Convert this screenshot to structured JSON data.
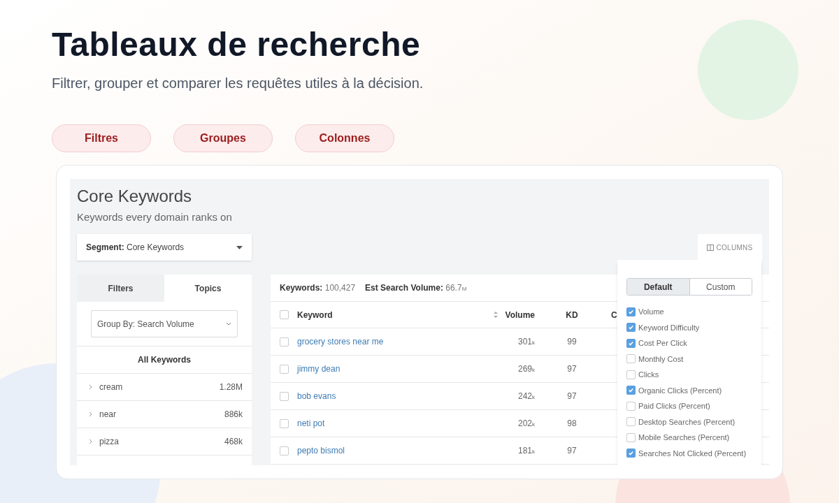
{
  "hero": {
    "title": "Tableaux de recherche",
    "subtitle": "Filtrer, grouper et comparer les requêtes utiles à la décision."
  },
  "pills": [
    {
      "label": "Filtres"
    },
    {
      "label": "Groupes"
    },
    {
      "label": "Colonnes"
    }
  ],
  "app": {
    "title": "Core Keywords",
    "subtitle": "Keywords every domain ranks on",
    "segment": {
      "label": "Segment:",
      "value": "Core Keywords"
    },
    "columns_button": "COLUMNS",
    "side_tabs": [
      {
        "label": "Filters",
        "selected": false
      },
      {
        "label": "Topics",
        "selected": true
      }
    ],
    "group_by": "Group By: Search Volume",
    "all_keywords": "All Keywords",
    "topics": [
      {
        "name": "cream",
        "volume": "1.28M"
      },
      {
        "name": "near",
        "volume": "886k"
      },
      {
        "name": "pizza",
        "volume": "468k"
      }
    ],
    "summary": [
      {
        "label": "Keywords:",
        "value": "100,427"
      },
      {
        "label": "Est Search Volume:",
        "value": "66.7",
        "unit": "M"
      }
    ],
    "table": {
      "all_selected": false,
      "columns": [
        "Keyword",
        "Volume",
        "KD",
        "C"
      ],
      "rows": [
        {
          "keyword": "grocery stores near me",
          "volume": "301",
          "unit": "k",
          "kd": "99",
          "checked": false
        },
        {
          "keyword": "jimmy dean",
          "volume": "269",
          "unit": "k",
          "kd": "97",
          "checked": false
        },
        {
          "keyword": "bob evans",
          "volume": "242",
          "unit": "k",
          "kd": "97",
          "checked": false
        },
        {
          "keyword": "neti pot",
          "volume": "202",
          "unit": "k",
          "kd": "98",
          "checked": false
        },
        {
          "keyword": "pepto bismol",
          "volume": "181",
          "unit": "k",
          "kd": "97",
          "checked": false
        }
      ]
    },
    "popover": {
      "modes": [
        {
          "label": "Default",
          "selected": true
        },
        {
          "label": "Custom",
          "selected": false
        }
      ],
      "options": [
        {
          "label": "Volume",
          "checked": true
        },
        {
          "label": "Keyword Difficulty",
          "checked": true
        },
        {
          "label": "Cost Per Click",
          "checked": true
        },
        {
          "label": "Monthly Cost",
          "checked": false
        },
        {
          "label": "Clicks",
          "checked": false
        },
        {
          "label": "Organic Clicks (Percent)",
          "checked": true
        },
        {
          "label": "Paid Clicks (Percent)",
          "checked": false
        },
        {
          "label": "Desktop Searches (Percent)",
          "checked": false
        },
        {
          "label": "Mobile Searches (Percent)",
          "checked": false
        },
        {
          "label": "Searches Not Clicked (Percent)",
          "checked": true
        }
      ]
    }
  }
}
